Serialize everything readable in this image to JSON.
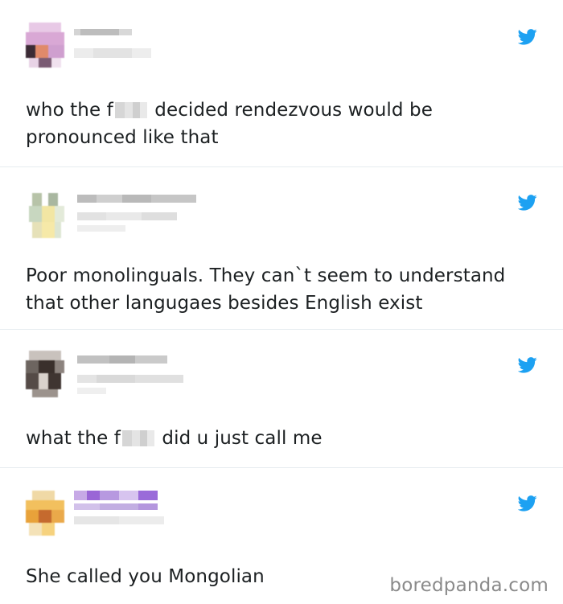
{
  "tweets": [
    {
      "text_before": "who the f",
      "text_after": " decided rendezvous would be pronounced like that"
    },
    {
      "text": "Poor monolinguals. They can`t seem to understand that other langugaes besides English exist"
    },
    {
      "text_before": "what the f",
      "text_after": " did u just call me"
    },
    {
      "text": "She called you Mongolian"
    }
  ],
  "watermark": "boredpanda.com",
  "colors": {
    "twitter_blue": "#1da1f2",
    "divider": "#e6ecf0",
    "text": "#1c2022"
  },
  "icons": [
    "twitter-bird-icon"
  ]
}
